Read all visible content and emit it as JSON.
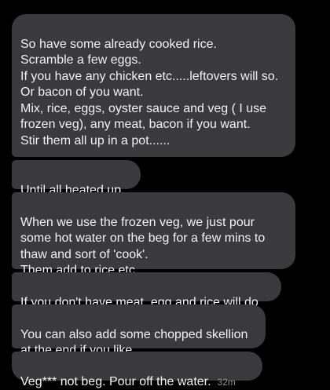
{
  "colors": {
    "background": "#000000",
    "bubble": "#3a3a3c",
    "text": "#f2f2f2",
    "timestamp": "#8e8e93"
  },
  "messages": [
    {
      "text": "So have some already cooked rice.\nScramble a few eggs.\nIf you have any chicken etc.....leftovers will so.\nOr bacon of you want.\nMix, rice, eggs, oyster sauce and veg ( I use frozen veg), any meat, bacon if you want.\nStir them all up in a pot......"
    },
    {
      "text": "Until all heated up."
    },
    {
      "text": "When we use the frozen veg, we just pour some hot water on the beg for a few mins to thaw and sort of 'cook'.\nThem add to rice etc."
    },
    {
      "text": "If you don't have meat, egg and rice will do"
    },
    {
      "text": "You can also add some chopped skellion at the  end if you like"
    },
    {
      "text": "Veg*** not beg. Pour off the water.",
      "time": "32m"
    }
  ]
}
